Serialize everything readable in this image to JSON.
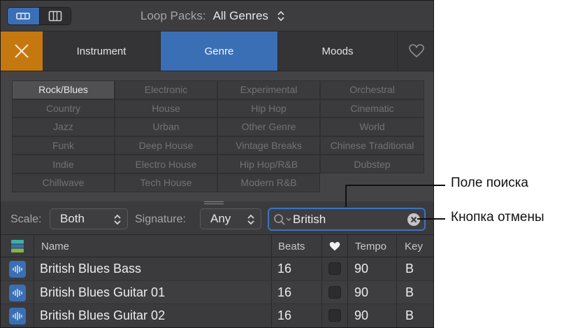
{
  "topbar": {
    "view_buttons": [
      {
        "icon": "button-view-icon",
        "active": true
      },
      {
        "icon": "column-view-icon",
        "active": false
      }
    ],
    "loop_packs_label": "Loop Packs:",
    "loop_packs_value": "All Genres"
  },
  "tabs": {
    "reset_icon": "close-icon",
    "items": [
      "Instrument",
      "Genre",
      "Moods"
    ],
    "active": "Genre",
    "favorites_icon": "heart-icon"
  },
  "keywords": {
    "active": "Rock/Blues",
    "items": [
      "Rock/Blues",
      "Electronic",
      "Experimental",
      "Orchestral",
      "Country",
      "House",
      "Hip Hop",
      "Cinematic",
      "Jazz",
      "Urban",
      "Other Genre",
      "World",
      "Funk",
      "Deep House",
      "Vintage Breaks",
      "Chinese Traditional",
      "Indie",
      "Electro House",
      "Hip Hop/R&B",
      "Dubstep",
      "Chillwave",
      "Tech House",
      "Modern R&B"
    ]
  },
  "filters": {
    "scale_label": "Scale:",
    "scale_value": "Both",
    "signature_label": "Signature:",
    "signature_value": "Any",
    "search_value": "British"
  },
  "table": {
    "columns": {
      "name": "Name",
      "beats": "Beats",
      "tempo": "Tempo",
      "key": "Key"
    },
    "rows": [
      {
        "name": "British Blues Bass",
        "beats": "16",
        "tempo": "90",
        "key": "B"
      },
      {
        "name": "British Blues Guitar 01",
        "beats": "16",
        "tempo": "90",
        "key": "B"
      },
      {
        "name": "British Blues Guitar 02",
        "beats": "16",
        "tempo": "90",
        "key": "B"
      }
    ]
  },
  "callouts": {
    "search_field": "Поле поиска",
    "cancel_button": "Кнопка отмены"
  },
  "colors": {
    "accent_blue": "#3b6fb5",
    "reset_orange": "#c5780f",
    "panel_bg": "#3b3b3d"
  }
}
